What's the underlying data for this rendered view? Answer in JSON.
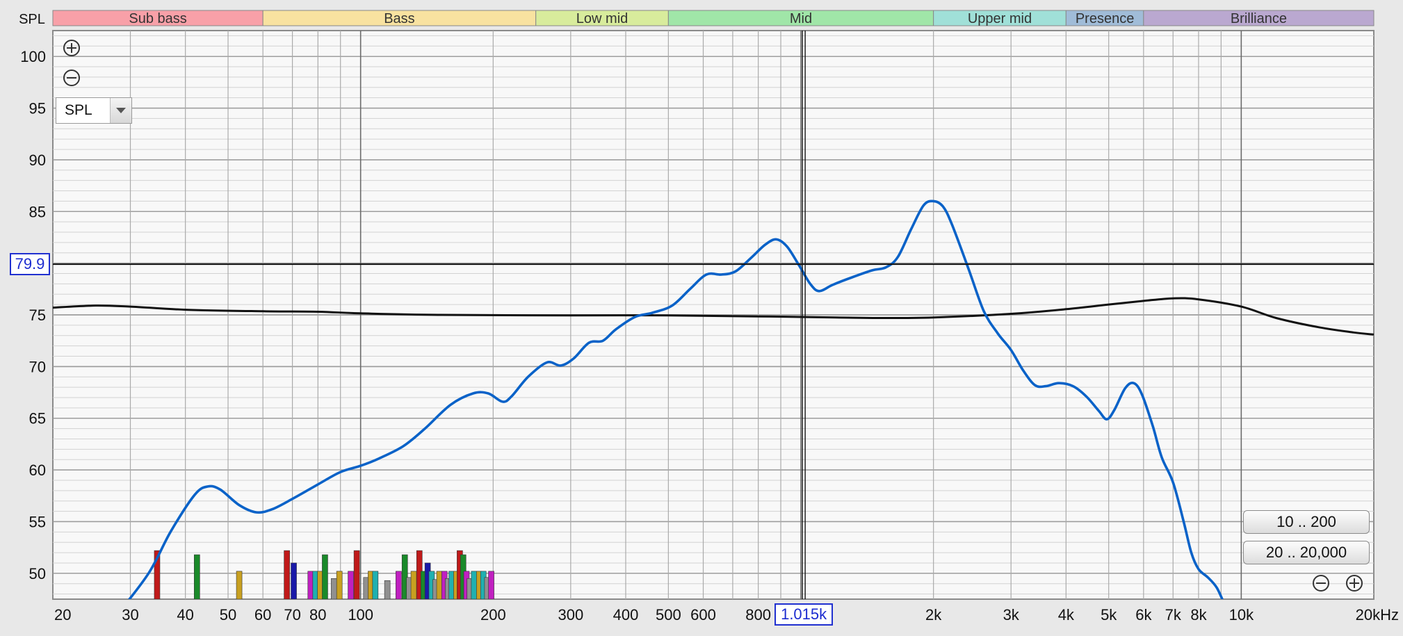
{
  "chart_data": {
    "type": "line",
    "ylabel": "SPL",
    "xunit": "kHz",
    "x_scale": "log",
    "xlim": [
      20,
      20000
    ],
    "ylim": [
      47.5,
      102.5
    ],
    "grid": true,
    "y_ticks": [
      50,
      55,
      60,
      65,
      70,
      75,
      80,
      85,
      90,
      95,
      100
    ],
    "x_ticks": [
      {
        "v": 20,
        "label": "20"
      },
      {
        "v": 30,
        "label": "30"
      },
      {
        "v": 40,
        "label": "40"
      },
      {
        "v": 50,
        "label": "50"
      },
      {
        "v": 60,
        "label": "60"
      },
      {
        "v": 70,
        "label": "70"
      },
      {
        "v": 80,
        "label": "80"
      },
      {
        "v": 100,
        "label": "100"
      },
      {
        "v": 200,
        "label": "200"
      },
      {
        "v": 300,
        "label": "300"
      },
      {
        "v": 400,
        "label": "400"
      },
      {
        "v": 500,
        "label": "500"
      },
      {
        "v": 600,
        "label": "600"
      },
      {
        "v": 800,
        "label": "800"
      },
      {
        "v": 2000,
        "label": "2k"
      },
      {
        "v": 3000,
        "label": "3k"
      },
      {
        "v": 4000,
        "label": "4k"
      },
      {
        "v": 5000,
        "label": "5k"
      },
      {
        "v": 6000,
        "label": "6k"
      },
      {
        "v": 7000,
        "label": "7k"
      },
      {
        "v": 8000,
        "label": "8k"
      },
      {
        "v": 10000,
        "label": "10k"
      },
      {
        "v": 20000,
        "label": "20kHz"
      }
    ],
    "bands": [
      {
        "name": "Sub bass",
        "from": 20,
        "to": 60,
        "color": "#f8a0a8"
      },
      {
        "name": "Bass",
        "from": 60,
        "to": 250,
        "color": "#f8e2a0"
      },
      {
        "name": "Low mid",
        "from": 250,
        "to": 500,
        "color": "#d8ec9c"
      },
      {
        "name": "Mid",
        "from": 500,
        "to": 2000,
        "color": "#a0e6a8"
      },
      {
        "name": "Upper mid",
        "from": 2000,
        "to": 4000,
        "color": "#a0e0d8"
      },
      {
        "name": "Presence",
        "from": 4000,
        "to": 6000,
        "color": "#a0bcd8"
      },
      {
        "name": "Brilliance",
        "from": 6000,
        "to": 20000,
        "color": "#baa8d0"
      }
    ],
    "series": [
      {
        "color": "#0a62c8",
        "points": [
          [
            28,
            46
          ],
          [
            33,
            50
          ],
          [
            37,
            54
          ],
          [
            42,
            57.6
          ],
          [
            45,
            58.4
          ],
          [
            48,
            58.1
          ],
          [
            53,
            56.6
          ],
          [
            58,
            55.9
          ],
          [
            63,
            56.2
          ],
          [
            70,
            57.2
          ],
          [
            80,
            58.6
          ],
          [
            90,
            59.8
          ],
          [
            100,
            60.4
          ],
          [
            110,
            61.1
          ],
          [
            125,
            62.3
          ],
          [
            140,
            64
          ],
          [
            160,
            66.3
          ],
          [
            180,
            67.4
          ],
          [
            195,
            67.4
          ],
          [
            210,
            66.6
          ],
          [
            220,
            67.1
          ],
          [
            240,
            69
          ],
          [
            265,
            70.4
          ],
          [
            285,
            70.1
          ],
          [
            305,
            70.8
          ],
          [
            330,
            72.3
          ],
          [
            355,
            72.5
          ],
          [
            380,
            73.6
          ],
          [
            420,
            74.8
          ],
          [
            460,
            75.2
          ],
          [
            510,
            75.9
          ],
          [
            560,
            77.5
          ],
          [
            610,
            78.9
          ],
          [
            660,
            78.9
          ],
          [
            710,
            79.2
          ],
          [
            770,
            80.5
          ],
          [
            830,
            81.8
          ],
          [
            880,
            82.3
          ],
          [
            930,
            81.6
          ],
          [
            990,
            79.8
          ],
          [
            1050,
            78
          ],
          [
            1100,
            77.3
          ],
          [
            1180,
            77.9
          ],
          [
            1300,
            78.6
          ],
          [
            1450,
            79.3
          ],
          [
            1560,
            79.6
          ],
          [
            1660,
            80.6
          ],
          [
            1780,
            83.3
          ],
          [
            1900,
            85.6
          ],
          [
            2000,
            86
          ],
          [
            2100,
            85.5
          ],
          [
            2200,
            83.8
          ],
          [
            2400,
            79.5
          ],
          [
            2600,
            75.4
          ],
          [
            2800,
            73.2
          ],
          [
            3000,
            71.6
          ],
          [
            3200,
            69.6
          ],
          [
            3400,
            68.2
          ],
          [
            3600,
            68.1
          ],
          [
            3850,
            68.4
          ],
          [
            4150,
            68.1
          ],
          [
            4450,
            67.1
          ],
          [
            4750,
            65.7
          ],
          [
            4950,
            64.9
          ],
          [
            5150,
            65.8
          ],
          [
            5450,
            67.9
          ],
          [
            5700,
            68.4
          ],
          [
            5950,
            67.3
          ],
          [
            6300,
            64.2
          ],
          [
            6600,
            61.2
          ],
          [
            7000,
            58.8
          ],
          [
            7400,
            55
          ],
          [
            7700,
            52
          ],
          [
            8000,
            50.4
          ],
          [
            8400,
            49.6
          ],
          [
            8800,
            48.6
          ],
          [
            9200,
            46.8
          ]
        ]
      },
      {
        "color": "#111111",
        "points": [
          [
            20,
            75.7
          ],
          [
            25,
            75.9
          ],
          [
            30,
            75.8
          ],
          [
            40,
            75.5
          ],
          [
            60,
            75.35
          ],
          [
            80,
            75.3
          ],
          [
            100,
            75.15
          ],
          [
            150,
            75
          ],
          [
            300,
            74.95
          ],
          [
            500,
            74.95
          ],
          [
            800,
            74.85
          ],
          [
            1200,
            74.75
          ],
          [
            1500,
            74.7
          ],
          [
            2000,
            74.75
          ],
          [
            3000,
            75.1
          ],
          [
            4000,
            75.55
          ],
          [
            5000,
            76
          ],
          [
            6000,
            76.35
          ],
          [
            7000,
            76.6
          ],
          [
            8000,
            76.5
          ],
          [
            10000,
            75.8
          ],
          [
            12000,
            74.7
          ],
          [
            15000,
            73.8
          ],
          [
            18000,
            73.3
          ],
          [
            20000,
            73.1
          ]
        ]
      }
    ],
    "bars": [
      {
        "f": 34.5,
        "y": 52.2,
        "c": "#c01a1a"
      },
      {
        "f": 42.5,
        "y": 51.8,
        "c": "#1a8a2a"
      },
      {
        "f": 53,
        "y": 50.2,
        "c": "#c8a020"
      },
      {
        "f": 68,
        "y": 52.2,
        "c": "#c01a1a"
      },
      {
        "f": 70.5,
        "y": 51,
        "c": "#1a1aa8"
      },
      {
        "f": 77,
        "y": 50.2,
        "c": "#c020c0"
      },
      {
        "f": 79,
        "y": 50.2,
        "c": "#20b0b0"
      },
      {
        "f": 81,
        "y": 50.2,
        "c": "#c8a020"
      },
      {
        "f": 83,
        "y": 51.8,
        "c": "#1a8a2a"
      },
      {
        "f": 87,
        "y": 49.5,
        "c": "#909090"
      },
      {
        "f": 89.5,
        "y": 50.2,
        "c": "#c8a020"
      },
      {
        "f": 95,
        "y": 50.2,
        "c": "#c020c0"
      },
      {
        "f": 98,
        "y": 52.2,
        "c": "#c01a1a"
      },
      {
        "f": 103,
        "y": 49.6,
        "c": "#909090"
      },
      {
        "f": 105.5,
        "y": 50.2,
        "c": "#c8a020"
      },
      {
        "f": 108,
        "y": 50.2,
        "c": "#20b0b0"
      },
      {
        "f": 115,
        "y": 49.3,
        "c": "#909090"
      },
      {
        "f": 122,
        "y": 50.2,
        "c": "#c020c0"
      },
      {
        "f": 126,
        "y": 51.8,
        "c": "#1a8a2a"
      },
      {
        "f": 129,
        "y": 49.6,
        "c": "#909090"
      },
      {
        "f": 132,
        "y": 50.2,
        "c": "#c8a020"
      },
      {
        "f": 136,
        "y": 52.2,
        "c": "#c01a1a"
      },
      {
        "f": 139,
        "y": 50.2,
        "c": "#1a8a2a"
      },
      {
        "f": 142,
        "y": 51,
        "c": "#1a1aa8"
      },
      {
        "f": 145,
        "y": 50.2,
        "c": "#20b0b0"
      },
      {
        "f": 148,
        "y": 49.4,
        "c": "#909090"
      },
      {
        "f": 151,
        "y": 50.2,
        "c": "#c8a020"
      },
      {
        "f": 155,
        "y": 50.2,
        "c": "#c020c0"
      },
      {
        "f": 158,
        "y": 49.5,
        "c": "#909090"
      },
      {
        "f": 161,
        "y": 50.2,
        "c": "#20b0b0"
      },
      {
        "f": 165,
        "y": 50.2,
        "c": "#c8a020"
      },
      {
        "f": 168,
        "y": 52.2,
        "c": "#c01a1a"
      },
      {
        "f": 171,
        "y": 51.8,
        "c": "#1a8a2a"
      },
      {
        "f": 174,
        "y": 50.2,
        "c": "#c020c0"
      },
      {
        "f": 177,
        "y": 49.5,
        "c": "#909090"
      },
      {
        "f": 181,
        "y": 50.2,
        "c": "#20b0b0"
      },
      {
        "f": 186,
        "y": 50.2,
        "c": "#c8a020"
      },
      {
        "f": 190,
        "y": 50.2,
        "c": "#20b0b0"
      },
      {
        "f": 194,
        "y": 49.6,
        "c": "#909090"
      },
      {
        "f": 198,
        "y": 50.2,
        "c": "#c020c0"
      }
    ],
    "cursor": {
      "freq": 1015,
      "freq_label": "1.015k",
      "spl": 79.9,
      "spl_label": "79.9"
    }
  },
  "controls": {
    "zoom_in_icon": "zoom-in-icon",
    "zoom_out_icon": "zoom-out-icon",
    "graph_select": "SPL",
    "range_low": "10 .. 200",
    "range_full": "20 .. 20,000"
  }
}
